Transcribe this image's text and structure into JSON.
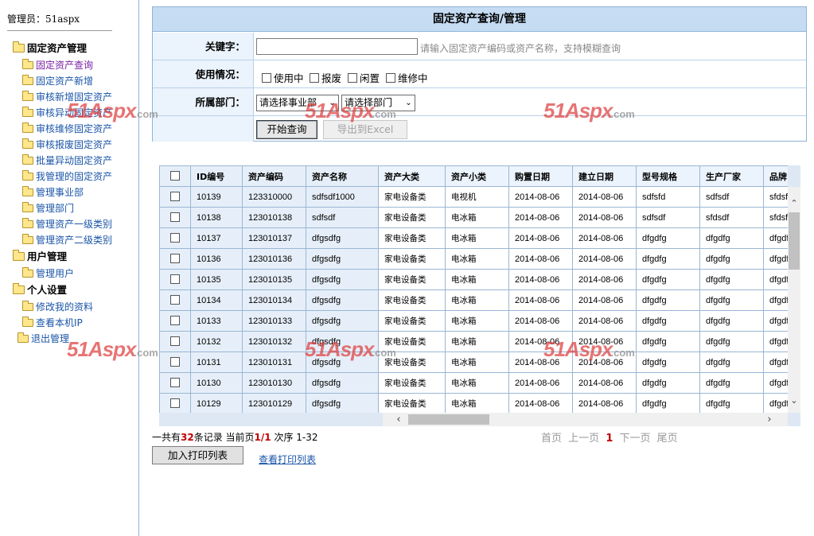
{
  "sidebar": {
    "admin_label": "管理员：51aspx",
    "groups": [
      {
        "label": "固定资产管理",
        "items": [
          {
            "label": "固定资产查询"
          },
          {
            "label": "固定资产新增"
          },
          {
            "label": "审核新增固定资产"
          },
          {
            "label": "审核异动固定资产"
          },
          {
            "label": "审核维修固定资产"
          },
          {
            "label": "审核报废固定资产"
          },
          {
            "label": "批量异动固定资产"
          },
          {
            "label": "我管理的固定资产"
          },
          {
            "label": "管理事业部"
          },
          {
            "label": "管理部门"
          },
          {
            "label": "管理资产一级类别"
          },
          {
            "label": "管理资产二级类别"
          }
        ]
      },
      {
        "label": "用户管理",
        "items": [
          {
            "label": "管理用户"
          }
        ]
      },
      {
        "label": "个人设置",
        "items": [
          {
            "label": "修改我的资料"
          },
          {
            "label": "查看本机IP"
          }
        ]
      }
    ],
    "logout_label": "退出管理"
  },
  "search": {
    "title": "固定资产查询/管理",
    "keyword_label": "关键字：",
    "keyword_value": "",
    "keyword_hint": "请输入固定资产编码或资产名称，支持模糊查询",
    "status_label": "使用情况：",
    "status_options": [
      "使用中",
      "报废",
      "闲置",
      "维修中"
    ],
    "dept_label": "所属部门：",
    "division_select": "请选择事业部",
    "dept_select": "请选择部门",
    "search_button": "开始查询",
    "export_button": "导出到Excel"
  },
  "table": {
    "columns": [
      "ID编号",
      "资产编码",
      "资产名称",
      "资产大类",
      "资产小类",
      "购置日期",
      "建立日期",
      "型号规格",
      "生产厂家",
      "品牌"
    ],
    "rows": [
      [
        "10139",
        "123310000",
        "sdfsdf1000",
        "家电设备类",
        "电视机",
        "2014-08-06",
        "2014-08-06",
        "sdfsfd",
        "sdfsdf",
        "sfdsf"
      ],
      [
        "10138",
        "123010138",
        "sdfsdf",
        "家电设备类",
        "电冰箱",
        "2014-08-06",
        "2014-08-06",
        "sdfsdf",
        "sfdsdf",
        "sfdsf"
      ],
      [
        "10137",
        "123010137",
        "dfgsdfg",
        "家电设备类",
        "电冰箱",
        "2014-08-06",
        "2014-08-06",
        "dfgdfg",
        "dfgdfg",
        "dfgdf"
      ],
      [
        "10136",
        "123010136",
        "dfgsdfg",
        "家电设备类",
        "电冰箱",
        "2014-08-06",
        "2014-08-06",
        "dfgdfg",
        "dfgdfg",
        "dfgdf"
      ],
      [
        "10135",
        "123010135",
        "dfgsdfg",
        "家电设备类",
        "电冰箱",
        "2014-08-06",
        "2014-08-06",
        "dfgdfg",
        "dfgdfg",
        "dfgdf"
      ],
      [
        "10134",
        "123010134",
        "dfgsdfg",
        "家电设备类",
        "电冰箱",
        "2014-08-06",
        "2014-08-06",
        "dfgdfg",
        "dfgdfg",
        "dfgdf"
      ],
      [
        "10133",
        "123010133",
        "dfgsdfg",
        "家电设备类",
        "电冰箱",
        "2014-08-06",
        "2014-08-06",
        "dfgdfg",
        "dfgdfg",
        "dfgdf"
      ],
      [
        "10132",
        "123010132",
        "dfgsdfg",
        "家电设备类",
        "电冰箱",
        "2014-08-06",
        "2014-08-06",
        "dfgdfg",
        "dfgdfg",
        "dfgdf"
      ],
      [
        "10131",
        "123010131",
        "dfgsdfg",
        "家电设备类",
        "电冰箱",
        "2014-08-06",
        "2014-08-06",
        "dfgdfg",
        "dfgdfg",
        "dfgdf"
      ],
      [
        "10130",
        "123010130",
        "dfgsdfg",
        "家电设备类",
        "电冰箱",
        "2014-08-06",
        "2014-08-06",
        "dfgdfg",
        "dfgdfg",
        "dfgdf"
      ],
      [
        "10129",
        "123010129",
        "dfgsdfg",
        "家电设备类",
        "电冰箱",
        "2014-08-06",
        "2014-08-06",
        "dfgdfg",
        "dfgdfg",
        "dfgdf"
      ]
    ]
  },
  "footer": {
    "total_prefix": "一共有",
    "total_count": "32",
    "total_suffix": "条记录  当前页",
    "page_current": "1/1",
    "range_text": " 次序  1-32",
    "pager": {
      "first": "首页",
      "prev": "上一页",
      "current": "1",
      "next": "下一页",
      "last": "尾页"
    },
    "print_button": "加入打印列表",
    "print_link": "查看打印列表"
  },
  "watermark": {
    "brand": "51Aspx",
    "suffix": ".com"
  },
  "colors": {
    "header_bg": "#c6dcf3",
    "border": "#8fb3d9",
    "link": "#1a55a8",
    "active_link": "#7a1fa2",
    "highlight": "#c00000"
  }
}
